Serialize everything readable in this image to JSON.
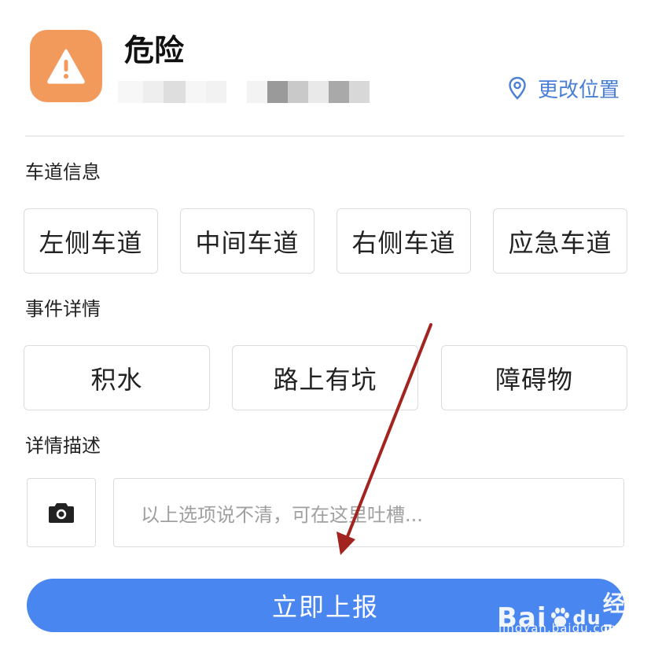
{
  "header": {
    "icon": "warning-triangle-icon",
    "icon_color": "#f19a5c",
    "title": "危险"
  },
  "location": {
    "icon": "location-pin-icon",
    "change_label": "更改位置",
    "link_color": "#4a7fd6"
  },
  "lane_section": {
    "label": "车道信息",
    "options": [
      "左侧车道",
      "中间车道",
      "右侧车道",
      "应急车道"
    ]
  },
  "event_section": {
    "label": "事件详情",
    "options": [
      "积水",
      "路上有坑",
      "障碍物"
    ]
  },
  "description_section": {
    "label": "详情描述",
    "camera_icon": "camera-icon",
    "placeholder": "以上选项说不清，可在这里吐槽..."
  },
  "submit": {
    "label": "立即上报",
    "color": "#4a86f0"
  },
  "annotation": {
    "arrow_color": "#a3241f"
  },
  "watermark": {
    "logo_prefix": "Bai",
    "logo_mid": "du",
    "logo_suffix": "经验",
    "url": "jingyan.baidu.com"
  }
}
